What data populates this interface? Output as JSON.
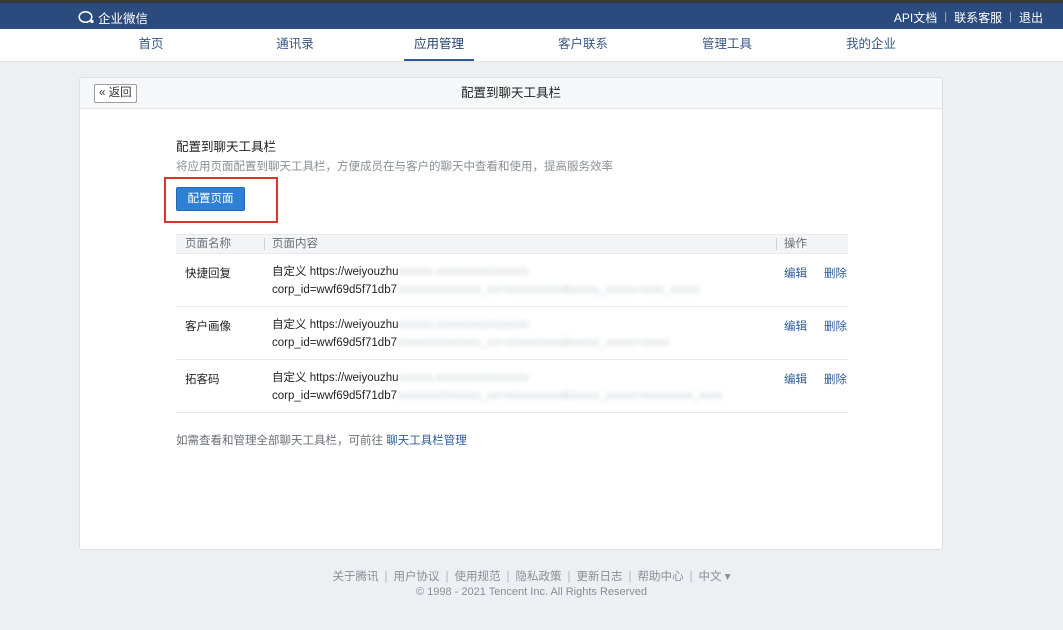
{
  "topbar": {
    "logo_text": "企业微信",
    "links": [
      "API文档",
      "联系客服",
      "退出"
    ],
    "separator": "|"
  },
  "nav": {
    "items": [
      "首页",
      "通讯录",
      "应用管理",
      "客户联系",
      "管理工具",
      "我的企业"
    ],
    "active": "应用管理"
  },
  "card": {
    "back_label": "« 返回",
    "title": "配置到聊天工具栏",
    "section_title": "配置到聊天工具栏",
    "section_desc": "将应用页面配置到聊天工具栏，方便成员在与客户的聊天中查看和使用，提高服务效率",
    "config_button": "配置页面"
  },
  "table": {
    "headers": [
      "页面名称",
      "页面内容",
      "操作"
    ],
    "rows": [
      {
        "name": "快捷回复",
        "content_line1": "自定义 https://weiyouzhu",
        "content_line2": "corp_id=wwf69d5f71db7",
        "blur1": "xxxxxx.xxxxxxxxx/xxxxx/x",
        "blur2": "xxxxxxxx/xxxxxx_xx=xxxxxxxxxx&xxxxx_xxxxx=xxxx_xxxxx"
      },
      {
        "name": "客户画像",
        "content_line1": "自定义 https://weiyouzhu",
        "content_line2": "corp_id=wwf69d5f71db7",
        "blur1": "xxxxxx.xxxxxxxxx/xxxxx/x",
        "blur2": "xxxxxxxx/xxxxxx_xx=xxxxxxxxxx&xxxxx_xxxxx=xxxxx"
      },
      {
        "name": "拓客码",
        "content_line1": "自定义 https://weiyouzhu",
        "content_line2": "corp_id=wwf69d5f71db7",
        "blur1": "xxxxxx.xxxxxxxxx/xxxxx/x",
        "blur2": "xxxxxxxx/xxxxxx_xx=xxxxxxxxxx&xxxxx_xxxxx=xxxxxxxxx_xxxx"
      }
    ],
    "action_edit": "编辑",
    "action_delete": "删除"
  },
  "footnote": {
    "text": "如需查看和管理全部聊天工具栏，可前往",
    "link": "聊天工具栏管理"
  },
  "footer": {
    "links": [
      "关于腾讯",
      "用户协议",
      "使用规范",
      "隐私政策",
      "更新日志",
      "帮助中心",
      "中文 ▾"
    ],
    "copyright": "© 1998 - 2021 Tencent Inc. All Rights Reserved"
  },
  "colors": {
    "topbar": "#2b4a7d",
    "accent": "#2f7fd4",
    "link": "#2d5a99",
    "highlight": "#d9362a"
  }
}
